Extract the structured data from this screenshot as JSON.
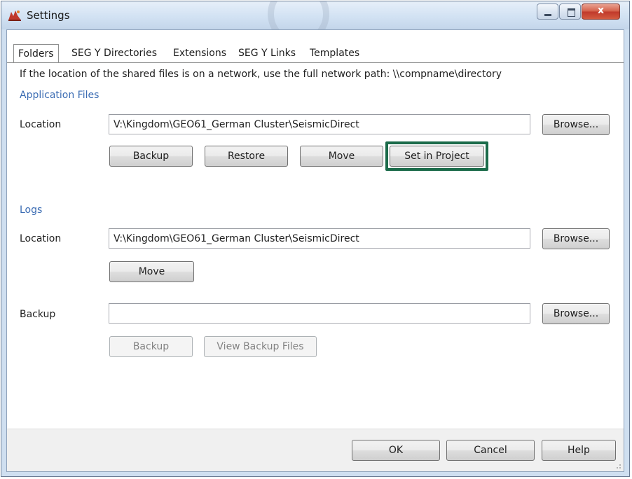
{
  "window": {
    "title": "Settings",
    "controls": {
      "minimize": "minimize",
      "maximize": "maximize",
      "close": "x"
    }
  },
  "tabs": [
    {
      "label": "Folders",
      "active": true
    },
    {
      "label": "SEG Y Directories",
      "active": false
    },
    {
      "label": "Extensions",
      "active": false
    },
    {
      "label": "SEG Y Links",
      "active": false
    },
    {
      "label": "Templates",
      "active": false
    }
  ],
  "folders": {
    "hint": "If the location of the shared files is on a network, use the full network path: \\\\compname\\directory",
    "application_files": {
      "heading": "Application Files",
      "location_label": "Location",
      "location_value": "V:\\Kingdom\\GEO61_German Cluster\\SeismicDirect",
      "browse_label": "Browse...",
      "buttons": {
        "backup": "Backup",
        "restore": "Restore",
        "move": "Move",
        "set_in_project": "Set in Project"
      }
    },
    "logs": {
      "heading": "Logs",
      "location_label": "Location",
      "location_value": "V:\\Kingdom\\GEO61_German Cluster\\SeismicDirect",
      "browse_label": "Browse...",
      "move_label": "Move"
    },
    "backup": {
      "label": "Backup",
      "value": "",
      "browse_label": "Browse...",
      "backup_button": "Backup",
      "view_files_button": "View Backup Files"
    }
  },
  "footer": {
    "ok": "OK",
    "cancel": "Cancel",
    "help": "Help"
  },
  "colors": {
    "highlight_border": "#1b6b4a",
    "group_heading": "#3b6cb3"
  }
}
